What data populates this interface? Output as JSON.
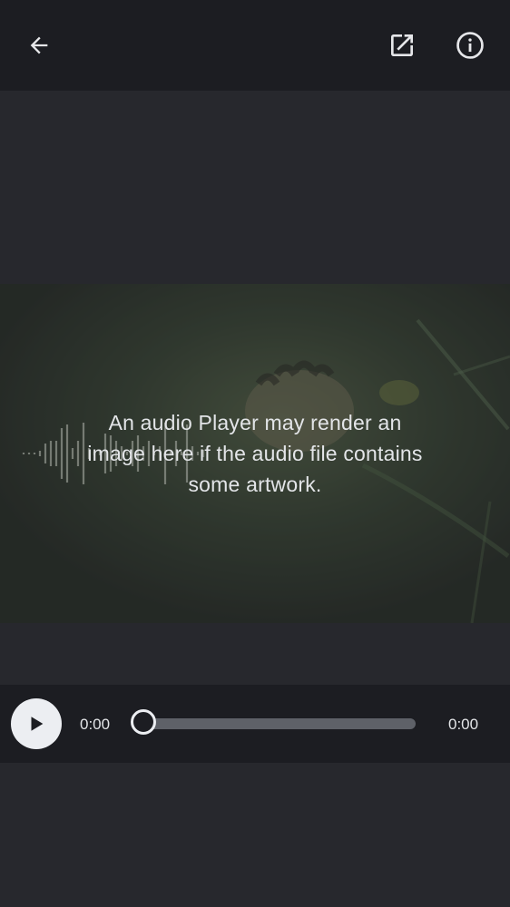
{
  "toolbar": {
    "back_icon": "arrow-left-icon",
    "open_external_icon": "open-in-new-icon",
    "info_icon": "info-icon"
  },
  "artwork": {
    "message": "An audio Player may render an image here if the audio file contains some artwork."
  },
  "player": {
    "play_icon": "play-icon",
    "current_time": "0:00",
    "duration": "0:00",
    "progress": 0
  },
  "colors": {
    "topbar_bg": "#1c1d22",
    "page_bg": "#27282d",
    "accent_light": "#eceef2",
    "track": "#5e6168"
  }
}
